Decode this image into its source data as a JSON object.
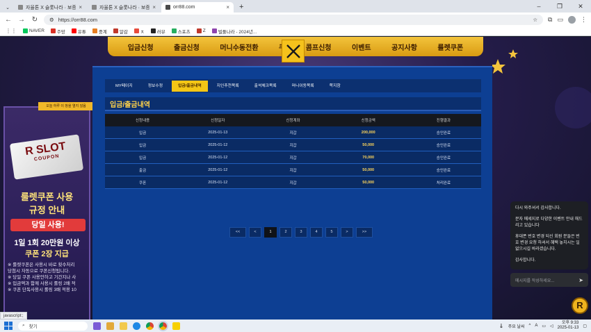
{
  "browser": {
    "tabs": [
      {
        "title": "자율톤 X 슬롯나라 · 보증금 2억",
        "active": false
      },
      {
        "title": "자율톤 X 슬롯나라 · 보증금 2억",
        "active": false
      },
      {
        "title": "orr88.com",
        "active": true
      }
    ],
    "url": "https://orr88.com",
    "bookmarks": [
      {
        "label": "NAVER",
        "color": "#03c75a"
      },
      {
        "label": "주망",
        "color": "#d93025"
      },
      {
        "label": "유튜",
        "color": "#ff0000"
      },
      {
        "label": "중계",
        "color": "#e67e22"
      },
      {
        "label": "알감",
        "color": "#c0392b"
      },
      {
        "label": "ㅊ",
        "color": "#e74c3c"
      },
      {
        "label": "러뷰",
        "color": "#222222"
      },
      {
        "label": "스포츠",
        "color": "#27ae60"
      },
      {
        "label": "Z",
        "color": "#c0392b"
      },
      {
        "label": "벌풀나라 - 2024년...",
        "color": "#8e44ad"
      }
    ],
    "status_text": "javascript:;"
  },
  "site": {
    "top_nav": [
      "입금신청",
      "출금신청",
      "머니수동전환",
      "쿠",
      "콤프신청",
      "이벤트",
      "공지사항",
      "룰렛쿠폰"
    ],
    "sub_tabs": [
      {
        "label": "MY페이지",
        "active": false
      },
      {
        "label": "정보수정",
        "active": false
      },
      {
        "label": "입금/출금내역",
        "active": true
      },
      {
        "label": "지인추천목록",
        "active": false
      },
      {
        "label": "출석체크목록",
        "active": false
      },
      {
        "label": "머니이동목록",
        "active": false
      },
      {
        "label": "쪽지함",
        "active": false
      }
    ],
    "section_title": "입금/출금내역",
    "table": {
      "headers": [
        "신청내용",
        "신청일자",
        "신청계좌",
        "신청금액",
        "진행결과"
      ],
      "rows": [
        [
          "입금",
          "2025-01-13",
          "지갑",
          "200,000",
          "승인완료"
        ],
        [
          "입금",
          "2025-01-12",
          "지갑",
          "50,000",
          "승인완료"
        ],
        [
          "입금",
          "2025-01-12",
          "지갑",
          "70,000",
          "승인완료"
        ],
        [
          "출금",
          "2025-01-12",
          "지갑",
          "50,000",
          "승인완료"
        ],
        [
          "쿠폰",
          "2025-01-12",
          "지갑",
          "50,000",
          "처리완료"
        ]
      ]
    },
    "pagination": [
      "<<",
      "<",
      "1",
      "2",
      "3",
      "4",
      "5",
      ">",
      ">>"
    ],
    "current_page": "1",
    "promo": {
      "ribbon": "오늘 하루 이 창을 열지 않음",
      "coupon_title": "R SLOT",
      "coupon_sub": "COUPON",
      "headline1": "룰렛쿠폰 사용",
      "headline2": "규정 안내",
      "badge": "당일 사용!",
      "line1": "1일 1회 20만원 이상",
      "line2": "쿠폰 2장 지급",
      "notes": [
        "※ 룰렛쿠폰은 사용시 바로 횟수처리",
        "당첨시 자동으로 쿠폰신청됩니다.",
        "※ 당일 쿠폰 사용안하고 기간지나 사",
        "※ 입금액과 함께 사용시 롤링 2배 적",
        "※ 쿠폰 단독사용시 롤링 3배 적용 10"
      ]
    },
    "chat": {
      "messages": [
        "다시 와주셔서 감사합니다.",
        "문자 메세지로 다양한 이벤트 안내 해드리고 있습니다",
        "휴대폰 번호 변경 되신 회원 분들은 번호 변경 요청 하셔서 혜택 놓치시는 일 없으시길 바라겠습니다.",
        "감사합니다."
      ],
      "input_placeholder": "메시지를 작성하세요...",
      "badge": "R"
    }
  },
  "taskbar": {
    "search_placeholder": "찾기",
    "weather": "주요 날씨",
    "ime": "A",
    "time": "오후 9:33",
    "date": "2025-01-13"
  }
}
